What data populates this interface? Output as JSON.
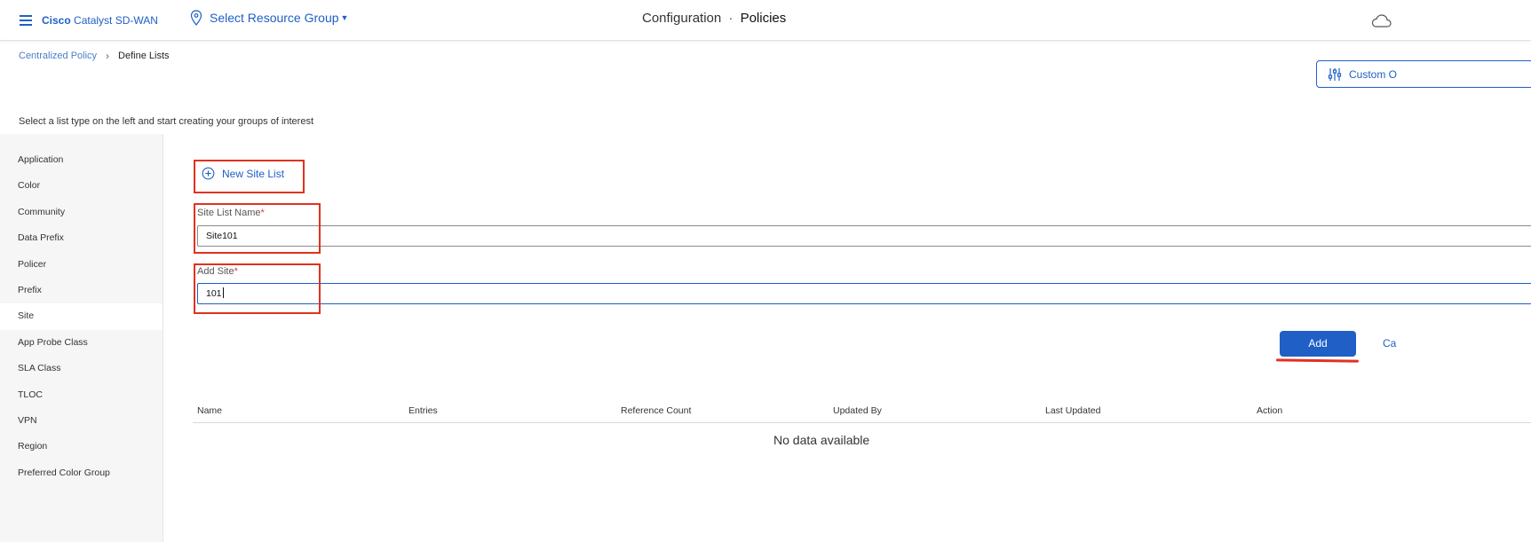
{
  "header": {
    "brand_bold": "Cisco",
    "brand_rest": " Catalyst SD-WAN",
    "resource_group": "Select Resource Group",
    "title_section": "Configuration",
    "title_separator": "·",
    "title_current": "Policies",
    "icons": [
      "hamburger-menu-icon",
      "location-pin-icon",
      "cloud-icon"
    ]
  },
  "breadcrumb": {
    "parent": "Centralized Policy",
    "current": "Define Lists"
  },
  "custom_options_label": "Custom O",
  "instruction": "Select a list type on the left and start creating your groups of interest",
  "sidebar": {
    "items": [
      {
        "label": "Application"
      },
      {
        "label": "Color"
      },
      {
        "label": "Community"
      },
      {
        "label": "Data Prefix"
      },
      {
        "label": "Policer"
      },
      {
        "label": "Prefix"
      },
      {
        "label": "Site"
      },
      {
        "label": "App Probe Class"
      },
      {
        "label": "SLA Class"
      },
      {
        "label": "TLOC"
      },
      {
        "label": "VPN"
      },
      {
        "label": "Region"
      },
      {
        "label": "Preferred Color Group"
      }
    ],
    "active": "Site"
  },
  "form": {
    "new_list_label": "New Site List",
    "name_label": "Site List Name",
    "name_value": "Site101",
    "site_label": "Add Site",
    "site_value": "101",
    "required_mark": "*",
    "add_button": "Add",
    "cancel_label": "Ca"
  },
  "table": {
    "columns": [
      "Name",
      "Entries",
      "Reference Count",
      "Updated By",
      "Last Updated",
      "Action"
    ],
    "empty_text": "No data available"
  },
  "colors": {
    "accent": "#1f5fc6",
    "annotation_red": "#e0321f"
  }
}
